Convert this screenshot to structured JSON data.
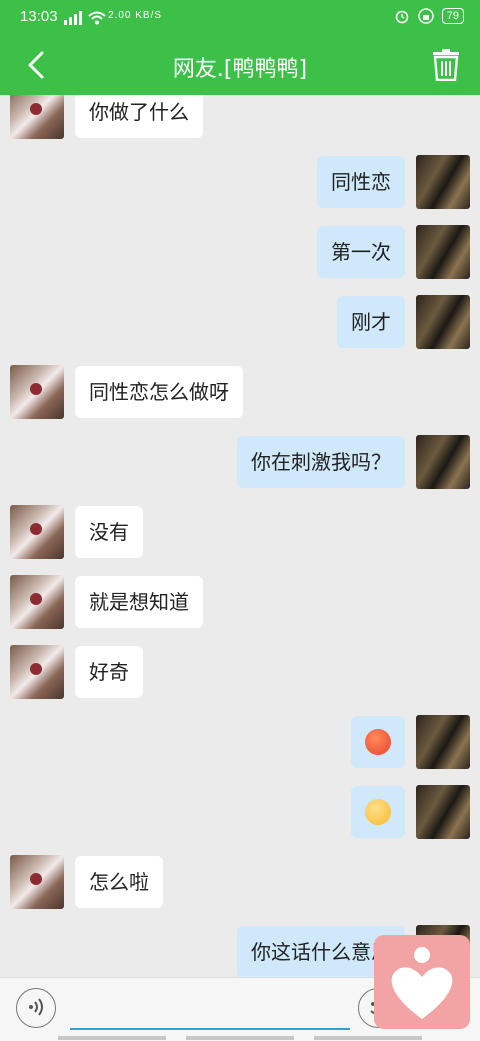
{
  "status_bar": {
    "time": "13:03",
    "network_speed": "2.00 KB/S",
    "battery": "79"
  },
  "header": {
    "title": "网友.[鸭鸭鸭]"
  },
  "colors": {
    "accent": "#3cc048",
    "incoming_bubble": "#ffffff",
    "outgoing_bubble": "#cfe9fb",
    "input_underline": "#2aa3d8",
    "heart_button": "#f2a3a3"
  },
  "messages": [
    {
      "side": "left",
      "text": "你做了什么"
    },
    {
      "side": "right",
      "text": "同性恋"
    },
    {
      "side": "right",
      "text": "第一次"
    },
    {
      "side": "right",
      "text": "刚才"
    },
    {
      "side": "left",
      "text": "同性恋怎么做呀"
    },
    {
      "side": "right",
      "text": "你在刺激我吗？"
    },
    {
      "side": "left",
      "text": "没有"
    },
    {
      "side": "left",
      "text": "就是想知道"
    },
    {
      "side": "left",
      "text": "好奇"
    },
    {
      "side": "right",
      "emoji": "angry-face-emoji"
    },
    {
      "side": "right",
      "emoji": "fuming-face-emoji"
    },
    {
      "side": "left",
      "text": "怎么啦"
    },
    {
      "side": "right",
      "text": "你这话什么意思"
    }
  ],
  "input": {
    "value": "",
    "placeholder": ""
  },
  "icons": {
    "back": "chevron-left-icon",
    "delete": "trash-icon",
    "voice": "voice-icon",
    "emoji": "emoji-icon",
    "floating": "heart-person-icon"
  }
}
